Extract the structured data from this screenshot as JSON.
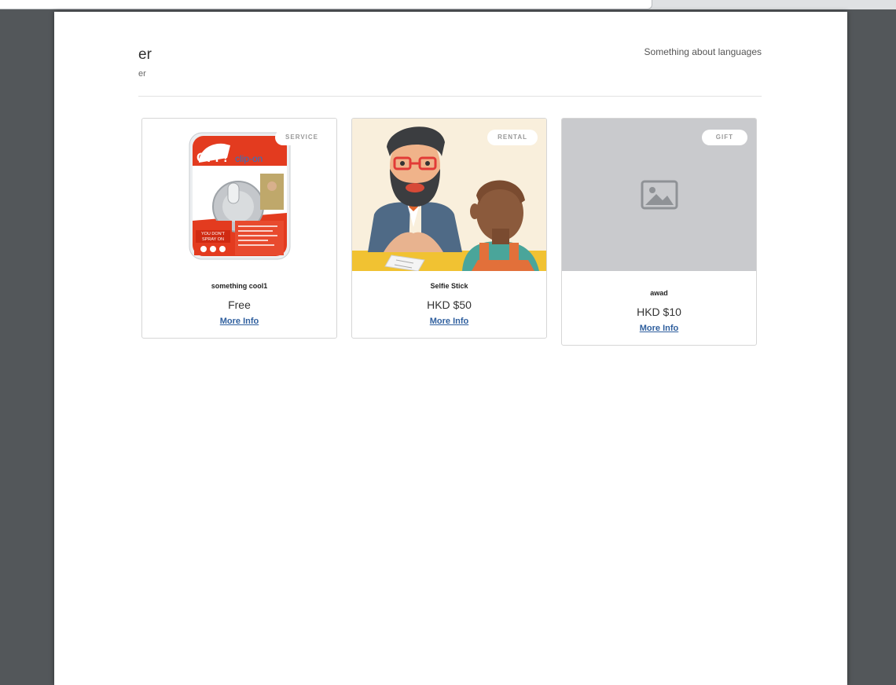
{
  "store": {
    "title": "er",
    "subtitle": "er",
    "tagline": "Something about languages"
  },
  "products": [
    {
      "badge": "SERVICE",
      "name": "something cool1",
      "price": "Free",
      "link": "More Info",
      "image": "off-clip-on-product-photo"
    },
    {
      "badge": "RENTAL",
      "name": "Selfie Stick",
      "price": "HKD $50",
      "link": "More Info",
      "image": "bearded-man-conversation-illustration"
    },
    {
      "badge": "GIFT",
      "name": "awad",
      "price": "HKD $10",
      "link": "More Info",
      "image": "image-placeholder-icon"
    }
  ],
  "images": {
    "product1": {
      "brand_logo": "OFF!",
      "product_line": "clip-on",
      "slogan": [
        "YOU DON'T",
        "SPRAY ON"
      ]
    }
  },
  "colors": {
    "link": "#2f5f9e",
    "placeholder_bg": "#c9cacd",
    "background": "#53575a"
  }
}
